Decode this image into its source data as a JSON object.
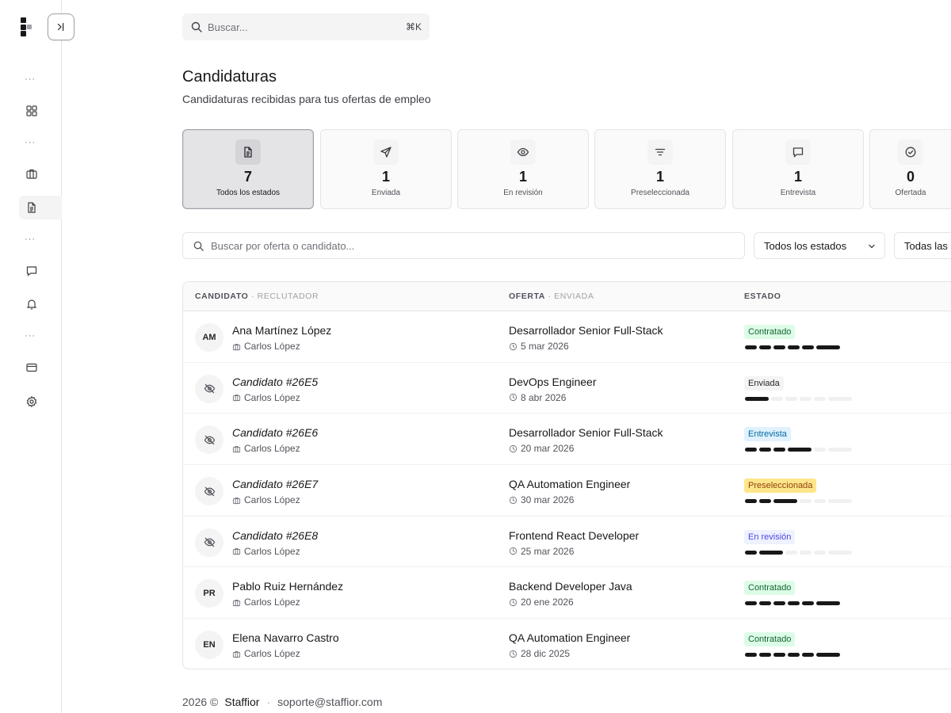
{
  "search": {
    "placeholder": "Buscar...",
    "shortcut": "⌘K"
  },
  "page": {
    "title": "Candidaturas",
    "subtitle": "Candidaturas recibidas para tus ofertas de empleo"
  },
  "stats": [
    {
      "count": "7",
      "label": "Todos los estados",
      "icon": "document-icon",
      "active": true
    },
    {
      "count": "1",
      "label": "Enviada",
      "icon": "send-icon"
    },
    {
      "count": "1",
      "label": "En revisión",
      "icon": "eye-icon"
    },
    {
      "count": "1",
      "label": "Preseleccionada",
      "icon": "filter-icon"
    },
    {
      "count": "1",
      "label": "Entrevista",
      "icon": "message-icon"
    },
    {
      "count": "0",
      "label": "Ofertada",
      "icon": "check-circle-icon"
    }
  ],
  "filters": {
    "search_placeholder": "Buscar por oferta o candidato...",
    "status_select": "Todos los estados",
    "second_select": "Todas las"
  },
  "table": {
    "headers": {
      "candidate": "CANDIDATO",
      "recruiter": "RECLUTADOR",
      "offer": "OFERTA",
      "sent": "ENVIADA",
      "status": "ESTADO"
    },
    "rows": [
      {
        "initials": "AM",
        "name": "Ana Martínez López",
        "anonymous": false,
        "recruiter": "Carlos López",
        "offer": "Desarrollador Senior Full-Stack",
        "date": "5 mar 2026",
        "status": "Contratado",
        "progress": 6
      },
      {
        "initials": "",
        "name": "Candidato #26E5",
        "anonymous": true,
        "recruiter": "Carlos López",
        "offer": "DevOps Engineer",
        "date": "8 abr 2026",
        "status": "Enviada",
        "progress": 1
      },
      {
        "initials": "",
        "name": "Candidato #26E6",
        "anonymous": true,
        "recruiter": "Carlos López",
        "offer": "Desarrollador Senior Full-Stack",
        "date": "20 mar 2026",
        "status": "Entrevista",
        "progress": 4
      },
      {
        "initials": "",
        "name": "Candidato #26E7",
        "anonymous": true,
        "recruiter": "Carlos López",
        "offer": "QA Automation Engineer",
        "date": "30 mar 2026",
        "status": "Preseleccionada",
        "progress": 3
      },
      {
        "initials": "",
        "name": "Candidato #26E8",
        "anonymous": true,
        "recruiter": "Carlos López",
        "offer": "Frontend React Developer",
        "date": "25 mar 2026",
        "status": "En revisión",
        "progress": 2
      },
      {
        "initials": "PR",
        "name": "Pablo Ruiz Hernández",
        "anonymous": false,
        "recruiter": "Carlos López",
        "offer": "Backend Developer Java",
        "date": "20 ene 2026",
        "status": "Contratado",
        "progress": 6
      },
      {
        "initials": "EN",
        "name": "Elena Navarro Castro",
        "anonymous": false,
        "recruiter": "Carlos López",
        "offer": "QA Automation Engineer",
        "date": "28 dic 2025",
        "status": "Contratado",
        "progress": 6
      }
    ]
  },
  "status_colors": {
    "Contratado": {
      "bg": "#dcfce7",
      "fg": "#166534"
    },
    "Enviada": {
      "bg": "#f4f4f5",
      "fg": "#27272a"
    },
    "Entrevista": {
      "bg": "#e0f2fe",
      "fg": "#0369a1"
    },
    "Preseleccionada": {
      "bg": "#fde68a",
      "fg": "#92400e"
    },
    "En revisión": {
      "bg": "#eef2ff",
      "fg": "#4f46e5"
    }
  },
  "footer": {
    "copyright": "2026 ©",
    "brand": "Staffior",
    "separator": "·",
    "email": "soporte@staffior.com"
  },
  "sidebar": {
    "dots": "···",
    "items": [
      "grid-icon",
      "briefcase-icon",
      "document-icon",
      "message-icon",
      "bell-icon",
      "card-icon",
      "gear-icon"
    ]
  }
}
